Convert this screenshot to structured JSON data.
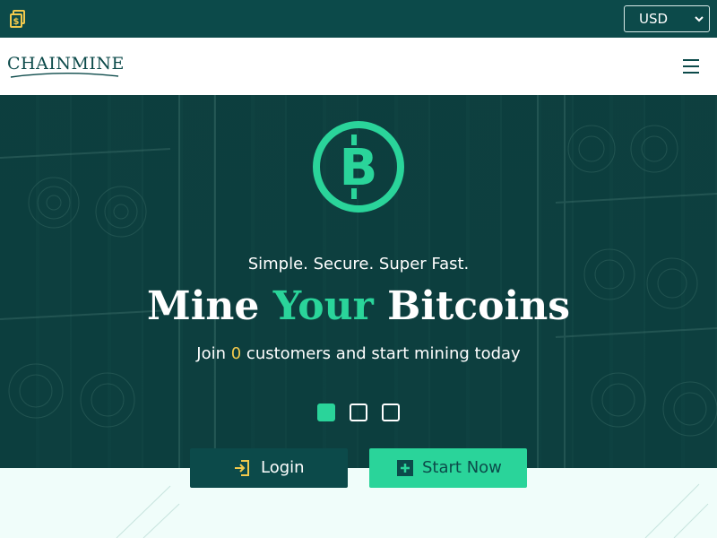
{
  "topbar": {
    "currency": {
      "selected": "USD"
    }
  },
  "navbar": {
    "logo_text": "CHAINMINE"
  },
  "hero": {
    "tagline": "Simple. Secure. Super Fast.",
    "headline": {
      "part1": "Mine ",
      "accent": "Your",
      "part2": " Bitcoins"
    },
    "subline": {
      "prefix": "Join ",
      "count": "0",
      "suffix": " customers and start mining today"
    },
    "carousel": {
      "slides": 3,
      "active_index": 0
    }
  },
  "actions": {
    "login_label": "Login",
    "start_label": "Start Now"
  },
  "colors": {
    "dark_teal": "#0c4a4a",
    "accent_green": "#2ad49a",
    "highlight_yellow": "#f2c94c",
    "bottom_bg": "#f0fdfa"
  },
  "icons": {
    "topbar": "coin-stack-icon",
    "hero": "bitcoin-circle-icon",
    "login": "login-icon",
    "start": "plus-square-icon",
    "menu": "hamburger-menu-icon"
  }
}
